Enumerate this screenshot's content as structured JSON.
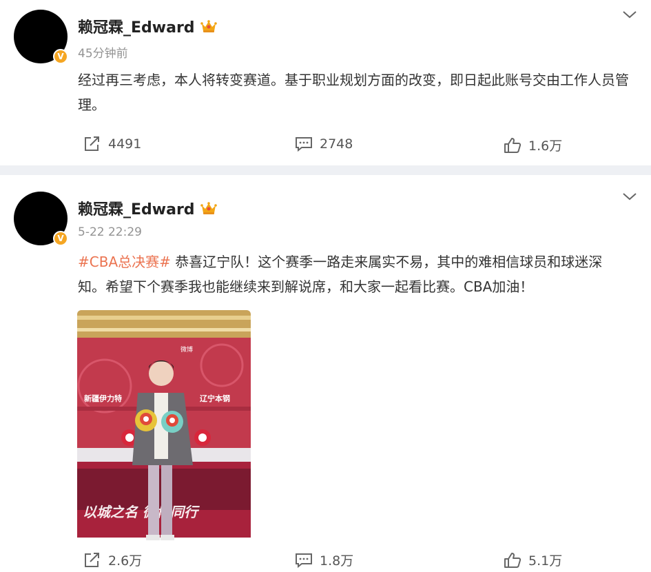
{
  "posts": [
    {
      "username": "赖冠霖_Edward",
      "badge": "V",
      "time": "45分钟前",
      "text": "经过再三考虑，本人将转变赛道。基于职业规划方面的改变，即日起此账号交由工作人员管理。",
      "repost_count": "4491",
      "comment_count": "2748",
      "like_count": "1.6万"
    },
    {
      "username": "赖冠霖_Edward",
      "badge": "V",
      "time": "5-22 22:29",
      "hashtag": "#CBA总决赛#",
      "text": " 恭喜辽宁队！这个赛季一路走来属实不易，其中的难相信球员和球迷深知。希望下个赛季我也能继续来到解说席，和大家一起看比赛。CBA加油！",
      "photo": {
        "backdrop_left": "新疆伊力特",
        "backdrop_right": "辽宁本钢",
        "backdrop_logo": "微博",
        "banner": "以城之名 微博同行"
      },
      "repost_count": "2.6万",
      "comment_count": "1.8万",
      "like_count": "5.1万"
    }
  ],
  "colors": {
    "hashtag": "#eb7350",
    "badge": "#f5a623",
    "divider": "#eef0f4"
  },
  "icons": [
    "repost-icon",
    "comment-icon",
    "like-icon",
    "chevron-down-icon",
    "crown-icon",
    "verified-badge"
  ]
}
